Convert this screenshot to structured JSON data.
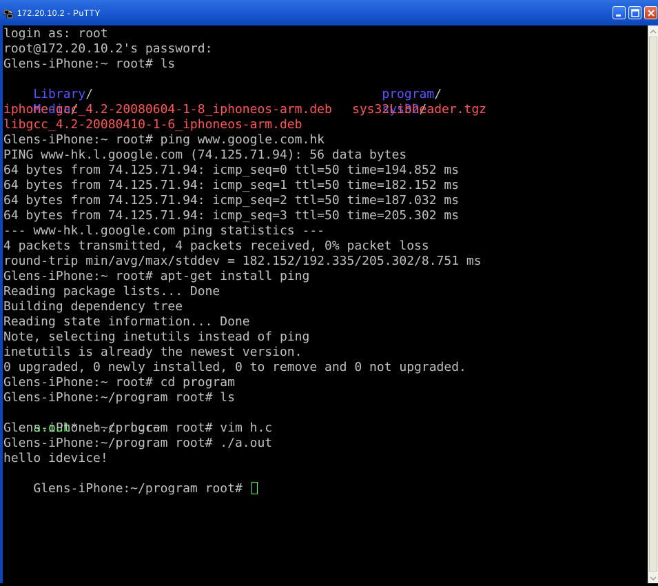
{
  "window": {
    "title": "172.20.10.2 - PuTTY",
    "icon": "putty-icon",
    "controls": [
      "minimize-icon",
      "maximize-icon",
      "close-icon"
    ]
  },
  "colors": {
    "background": "#000000",
    "text": "#c0c0c0",
    "directory": "#5555ff",
    "archive": "#ff5555",
    "executable": "#55ff55",
    "titlebar": "#1f5fd8"
  },
  "terminal": {
    "lines": [
      "login as: root",
      "root@172.20.10.2's password:",
      "Glens-iPhone:~ root# ls",
      "",
      "",
      "",
      "",
      "Glens-iPhone:~ root# ping www.google.com.hk",
      "PING www-hk.l.google.com (74.125.71.94): 56 data bytes",
      "64 bytes from 74.125.71.94: icmp_seq=0 ttl=50 time=194.852 ms",
      "64 bytes from 74.125.71.94: icmp_seq=1 ttl=50 time=182.152 ms",
      "64 bytes from 74.125.71.94: icmp_seq=2 ttl=50 time=187.032 ms",
      "64 bytes from 74.125.71.94: icmp_seq=3 ttl=50 time=205.302 ms",
      "--- www-hk.l.google.com ping statistics ---",
      "4 packets transmitted, 4 packets received, 0% packet loss",
      "round-trip min/avg/max/stddev = 182.152/192.335/205.302/8.751 ms",
      "Glens-iPhone:~ root# apt-get install ping",
      "Reading package lists... Done",
      "Building dependency tree",
      "Reading state information... Done",
      "Note, selecting inetutils instead of ping",
      "inetutils is already the newest version.",
      "0 upgraded, 0 newly installed, 0 to remove and 0 not upgraded.",
      "Glens-iPhone:~ root# cd program",
      "Glens-iPhone:~/program root# ls",
      "",
      "Glens-iPhone:~/program root# vim h.c",
      "Glens-iPhone:~/program root# ./a.out",
      "hello idevice!",
      ""
    ],
    "ls_home": {
      "row1_left": "Library",
      "row1_right": "program",
      "row2_left": "Media",
      "row2_right": "sys32",
      "row3_left": "iphone-gcc_4.2-20080604-1-8_iphoneos-arm.deb",
      "row3_right": "sys32Libheader.tgz",
      "row4_left": "libgcc_4.2-20080410-1-6_iphoneos-arm.deb",
      "slash": "/"
    },
    "ls_program": {
      "exe": "a.out",
      "exe_mark": "*",
      "rest": "  h.c  h.c~"
    },
    "prompt": "Glens-iPhone:~/program root# "
  }
}
